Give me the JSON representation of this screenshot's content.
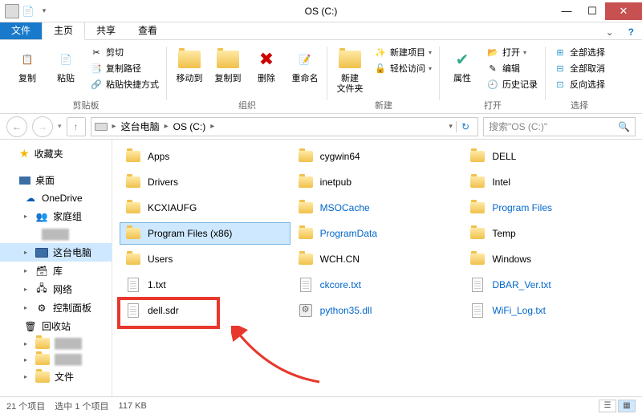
{
  "window": {
    "title": "OS (C:)"
  },
  "tabs": {
    "file": "文件",
    "home": "主页",
    "share": "共享",
    "view": "查看"
  },
  "ribbon": {
    "clipboard": {
      "label": "剪贴板",
      "copy": "复制",
      "paste": "粘贴",
      "cut": "剪切",
      "copypath": "复制路径",
      "shortcut": "粘贴快捷方式"
    },
    "organize": {
      "label": "组织",
      "moveto": "移动到",
      "copyto": "复制到",
      "delete": "删除",
      "rename": "重命名"
    },
    "new": {
      "label": "新建",
      "newfolder": "新建\n文件夹",
      "newitem": "新建项目",
      "easyaccess": "轻松访问"
    },
    "open": {
      "label": "打开",
      "properties": "属性",
      "open": "打开",
      "edit": "编辑",
      "history": "历史记录"
    },
    "select": {
      "label": "选择",
      "selectall": "全部选择",
      "selectnone": "全部取消",
      "invert": "反向选择"
    }
  },
  "breadcrumb": {
    "thispc": "这台电脑",
    "drive": "OS (C:)"
  },
  "search": {
    "placeholder": "搜索\"OS (C:)\""
  },
  "sidebar": {
    "favorites": "收藏夹",
    "desktop": "桌面",
    "onedrive": "OneDrive",
    "homegroup": "家庭组",
    "thispc": "这台电脑",
    "libraries": "库",
    "network": "网络",
    "controlpanel": "控制面板",
    "recyclebin": "回收站",
    "docs": "文件"
  },
  "files": {
    "col1": [
      {
        "name": "Apps",
        "type": "folder"
      },
      {
        "name": "Drivers",
        "type": "folder"
      },
      {
        "name": "KCXIAUFG",
        "type": "folder"
      },
      {
        "name": "Program Files (x86)",
        "type": "folder",
        "selected": true
      },
      {
        "name": "Users",
        "type": "folder"
      },
      {
        "name": "1.txt",
        "type": "file"
      },
      {
        "name": "dell.sdr",
        "type": "file"
      }
    ],
    "col2": [
      {
        "name": "cygwin64",
        "type": "folder"
      },
      {
        "name": "inetpub",
        "type": "folder"
      },
      {
        "name": "MSOCache",
        "type": "folder",
        "link": true
      },
      {
        "name": "ProgramData",
        "type": "folder",
        "link": true
      },
      {
        "name": "WCH.CN",
        "type": "folder"
      },
      {
        "name": "ckcore.txt",
        "type": "file",
        "link": true
      },
      {
        "name": "python35.dll",
        "type": "dll",
        "link": true
      }
    ],
    "col3": [
      {
        "name": "DELL",
        "type": "folder"
      },
      {
        "name": "Intel",
        "type": "folder"
      },
      {
        "name": "Program Files",
        "type": "folder",
        "link": true
      },
      {
        "name": "Temp",
        "type": "folder"
      },
      {
        "name": "Windows",
        "type": "folder"
      },
      {
        "name": "DBAR_Ver.txt",
        "type": "file",
        "link": true
      },
      {
        "name": "WiFi_Log.txt",
        "type": "file",
        "link": true
      }
    ]
  },
  "status": {
    "count": "21 个项目",
    "selected": "选中 1 个项目",
    "size": "117 KB"
  }
}
